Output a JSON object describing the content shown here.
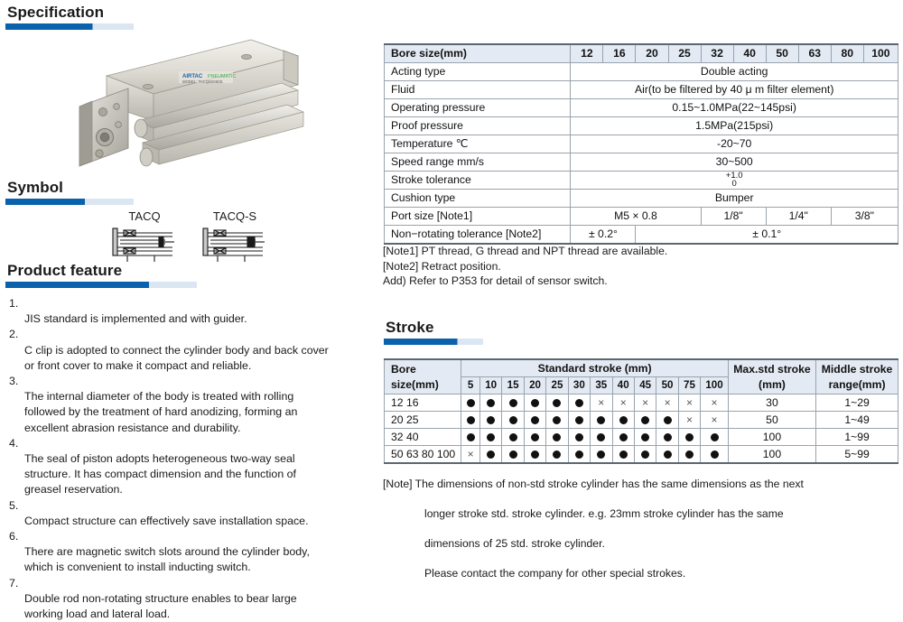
{
  "sections": {
    "specification": "Specification",
    "symbol": "Symbol",
    "product_feature": "Product feature",
    "stroke": "Stroke"
  },
  "accent_color": "#0a62ad",
  "accent_track_color": "#dbe6f3",
  "symbol": {
    "items": [
      {
        "label": "TACQ",
        "icon": "cylinder-symbol"
      },
      {
        "label": "TACQ-S",
        "icon": "cylinder-symbol-spring"
      }
    ]
  },
  "product_photo": {
    "icon": "compact-cylinder-photo",
    "brand_text": "AIRTAC",
    "model_text": "MODEL: TACQ50X50S"
  },
  "product_features": [
    {
      "num": "1.",
      "text": "JIS standard is implemented and with guider."
    },
    {
      "num": "2.",
      "text": "C clip is adopted to connect the cylinder body and back cover\nor front cover to make it compact and reliable."
    },
    {
      "num": "3.",
      "text": "The internal diameter of the body is treated with rolling\nfollowed by the treatment of hard anodizing, forming an\nexcellent abrasion resistance and durability."
    },
    {
      "num": "4.",
      "text": "The seal of piston adopts heterogeneous two-way seal\nstructure. It has compact dimension and the function of\ngreasel reservation."
    },
    {
      "num": "5.",
      "text": "Compact structure can effectively save installation space."
    },
    {
      "num": "6.",
      "text": "There are magnetic switch slots around the cylinder body,\nwhich is convenient to install inducting switch."
    },
    {
      "num": "7.",
      "text": "Double rod non-rotating structure enables to bear large\nworking load and lateral load."
    }
  ],
  "spec_table": {
    "header_label": "Bore size(mm)",
    "bore_sizes": [
      "12",
      "16",
      "20",
      "25",
      "32",
      "40",
      "50",
      "63",
      "80",
      "100"
    ],
    "rows": [
      {
        "label": "Acting type",
        "cells": [
          {
            "text": "Double acting",
            "span": 10
          }
        ]
      },
      {
        "label": "Fluid",
        "cells": [
          {
            "text": "Air(to be filtered by 40 μ m filter element)",
            "span": 10
          }
        ]
      },
      {
        "label": "Operating pressure",
        "cells": [
          {
            "text": "0.15~1.0MPa(22~145psi)",
            "span": 10
          }
        ]
      },
      {
        "label": "Proof pressure",
        "cells": [
          {
            "text": "1.5MPa(215psi)",
            "span": 10
          }
        ]
      },
      {
        "label": "Temperature  ℃",
        "cells": [
          {
            "text": "-20~70",
            "span": 10
          }
        ]
      },
      {
        "label": "Speed range  mm/s",
        "cells": [
          {
            "text": "30~500",
            "span": 10
          }
        ]
      },
      {
        "label": "Stroke tolerance",
        "cells": [
          {
            "text": "",
            "span": 10,
            "fraction": {
              "top": "+1.0",
              "bottom": "0"
            }
          }
        ]
      },
      {
        "label": "Cushion type",
        "cells": [
          {
            "text": "Bumper",
            "span": 10
          }
        ]
      },
      {
        "label": "Port size  [Note1]",
        "cells": [
          {
            "text": "M5 × 0.8",
            "span": 4
          },
          {
            "text": "1/8\"",
            "span": 2
          },
          {
            "text": "1/4\"",
            "span": 2
          },
          {
            "text": "3/8\"",
            "span": 2
          }
        ]
      },
      {
        "label": "Non−rotating tolerance [Note2]",
        "cells": [
          {
            "text": "± 0.2°",
            "span": 2
          },
          {
            "text": "± 0.1°",
            "span": 8
          }
        ]
      }
    ]
  },
  "spec_notes": "[Note1] PT thread, G thread and NPT thread are available.\n[Note2] Retract position.\nAdd) Refer to P353 for detail of sensor switch.",
  "stroke_table": {
    "bore_header_line1": "Bore",
    "bore_header_line2": "size(mm)",
    "standard_stroke_header": "Standard stroke (mm)",
    "max_std_header_line1": "Max.std stroke",
    "max_std_header_line2": "(mm)",
    "middle_header_line1": "Middle stroke",
    "middle_header_line2": "range(mm)",
    "stroke_values": [
      "5",
      "10",
      "15",
      "20",
      "25",
      "30",
      "35",
      "40",
      "45",
      "50",
      "75",
      "100"
    ],
    "rows": [
      {
        "bore": "12  16",
        "marks": [
          "dot",
          "dot",
          "dot",
          "dot",
          "dot",
          "dot",
          "x",
          "x",
          "x",
          "x",
          "x",
          "x"
        ],
        "max_std": "30",
        "middle_range": "1~29"
      },
      {
        "bore": "20  25",
        "marks": [
          "dot",
          "dot",
          "dot",
          "dot",
          "dot",
          "dot",
          "dot",
          "dot",
          "dot",
          "dot",
          "x",
          "x"
        ],
        "max_std": "50",
        "middle_range": "1~49"
      },
      {
        "bore": "32  40",
        "marks": [
          "dot",
          "dot",
          "dot",
          "dot",
          "dot",
          "dot",
          "dot",
          "dot",
          "dot",
          "dot",
          "dot",
          "dot"
        ],
        "max_std": "100",
        "middle_range": "1~99"
      },
      {
        "bore": "50  63  80  100",
        "marks": [
          "x",
          "dot",
          "dot",
          "dot",
          "dot",
          "dot",
          "dot",
          "dot",
          "dot",
          "dot",
          "dot",
          "dot"
        ],
        "max_std": "100",
        "middle_range": "5~99"
      }
    ]
  },
  "stroke_notes": {
    "line1": "[Note] The dimensions of non-std stroke cylinder has the same dimensions as the next",
    "line2": "longer stroke std. stroke cylinder. e.g. 23mm stroke cylinder has the same",
    "line3": "dimensions of 25 std. stroke cylinder.",
    "line4": "Please contact the company for other special strokes."
  }
}
